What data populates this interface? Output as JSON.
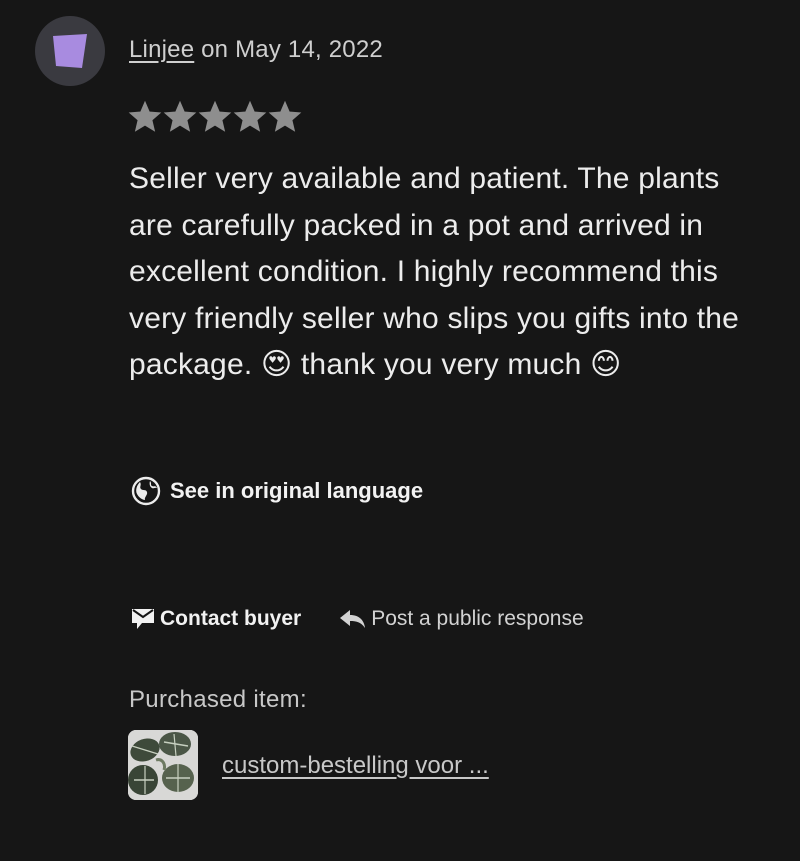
{
  "colors": {
    "background": "#161616",
    "avatar_bg": "#3a3a40",
    "avatar_shape": "#a88be0",
    "star": "#8e8e8e",
    "text": "#ececec",
    "muted_text": "#c8c8c8"
  },
  "review": {
    "author": "Linjee",
    "date_text": " on May 14, 2022",
    "rating": 5,
    "rating_max": 5,
    "text": "Seller very available and patient. The plants are carefully packed in a pot and arrived in excellent condition. I highly recommend this very friendly seller who slips you gifts into the package. 😍 thank you very much 😊",
    "translate_label": "See in original language",
    "translate_icon": "globe-icon"
  },
  "actions": {
    "contact_label": "Contact buyer",
    "contact_icon": "message-icon",
    "respond_label": "Post a public response",
    "respond_icon": "reply-arrow-icon"
  },
  "purchase": {
    "label": "Purchased item:",
    "item_title": "custom-bestelling voor ..."
  }
}
